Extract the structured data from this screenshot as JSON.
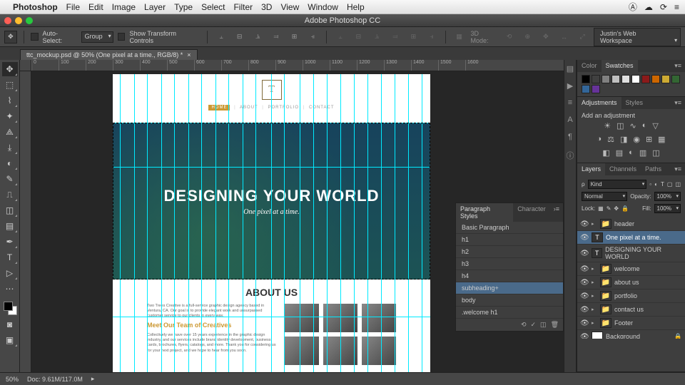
{
  "mac_menu": {
    "app": "Photoshop",
    "items": [
      "File",
      "Edit",
      "Image",
      "Layer",
      "Type",
      "Select",
      "Filter",
      "3D",
      "View",
      "Window",
      "Help"
    ]
  },
  "title_bar": "Adobe Photoshop CC",
  "options": {
    "auto_select": "Auto-Select:",
    "group": "Group",
    "show_transform": "Show Transform Controls",
    "mode3d": "3D Mode:",
    "workspace": "Justin's Web Workspace"
  },
  "doc_tab": "ttc_mockup.psd @ 50% (One pixel at a time., RGB/8) *",
  "ruler_marks": [
    "0",
    "100",
    "200",
    "300",
    "400",
    "500",
    "600",
    "700",
    "800",
    "900",
    "1000",
    "1100",
    "1200",
    "1300",
    "1400",
    "1500",
    "1600"
  ],
  "site": {
    "nav": {
      "home": "HOME",
      "about": "ABOUT",
      "portfolio": "PORTFOLIO",
      "contact": "CONTACT"
    },
    "hero_heading": "DESIGNING YOUR WORLD",
    "hero_sub": "One pixel at a time.",
    "about_heading": "ABOUT US",
    "about_p1": "Two Trees Creative is a full-service graphic design agency based in Ventura, CA. Our goal is to provide elegant work and unsurpassed customer service to our clients in every way.",
    "team_heading": "Meet Our Team of Creatives",
    "about_p2": "Collectively we have over 15 years experience in the graphic design industry, and our services include brand identity development, business cards, brochures, flyers, catalogs, and more. Thank you for considering us for your next project, and we hope to hear from you soon."
  },
  "para_panel": {
    "tab1": "Paragraph Styles",
    "tab2": "Character",
    "items": [
      "Basic Paragraph",
      "h1",
      "h2",
      "h3",
      "h4",
      "subheading+",
      "body",
      ".welcome h1"
    ],
    "selected": 5
  },
  "panels": {
    "color_tab": "Color",
    "swatches_tab": "Swatches",
    "swatches": [
      "#000",
      "#404040",
      "#808080",
      "#c0c0c0",
      "#e0e0e0",
      "#fff",
      "#8b1a1a",
      "#cc6600",
      "#ccaa33",
      "#336633",
      "#336699",
      "#663399"
    ],
    "adjustments_tab": "Adjustments",
    "styles_tab": "Styles",
    "add_adjustment": "Add an adjustment",
    "layers_tab": "Layers",
    "channels_tab": "Channels",
    "paths_tab": "Paths",
    "kind": "Kind",
    "blend": "Normal",
    "opacity_label": "Opacity:",
    "opacity": "100%",
    "lock_label": "Lock:",
    "fill_label": "Fill:",
    "fill": "100%",
    "layers": [
      {
        "name": "header",
        "type": "folder"
      },
      {
        "name": "One pixel at a time.",
        "type": "text",
        "selected": true
      },
      {
        "name": "DESIGNING YOUR WORLD",
        "type": "text"
      },
      {
        "name": "welcome",
        "type": "folder"
      },
      {
        "name": "about us",
        "type": "folder"
      },
      {
        "name": "portfolio",
        "type": "folder"
      },
      {
        "name": "contact us",
        "type": "folder"
      },
      {
        "name": "Footer",
        "type": "folder"
      },
      {
        "name": "Background",
        "type": "bg",
        "locked": true
      }
    ]
  },
  "status": {
    "zoom": "50%",
    "doc": "Doc: 9.61M/117.0M"
  }
}
